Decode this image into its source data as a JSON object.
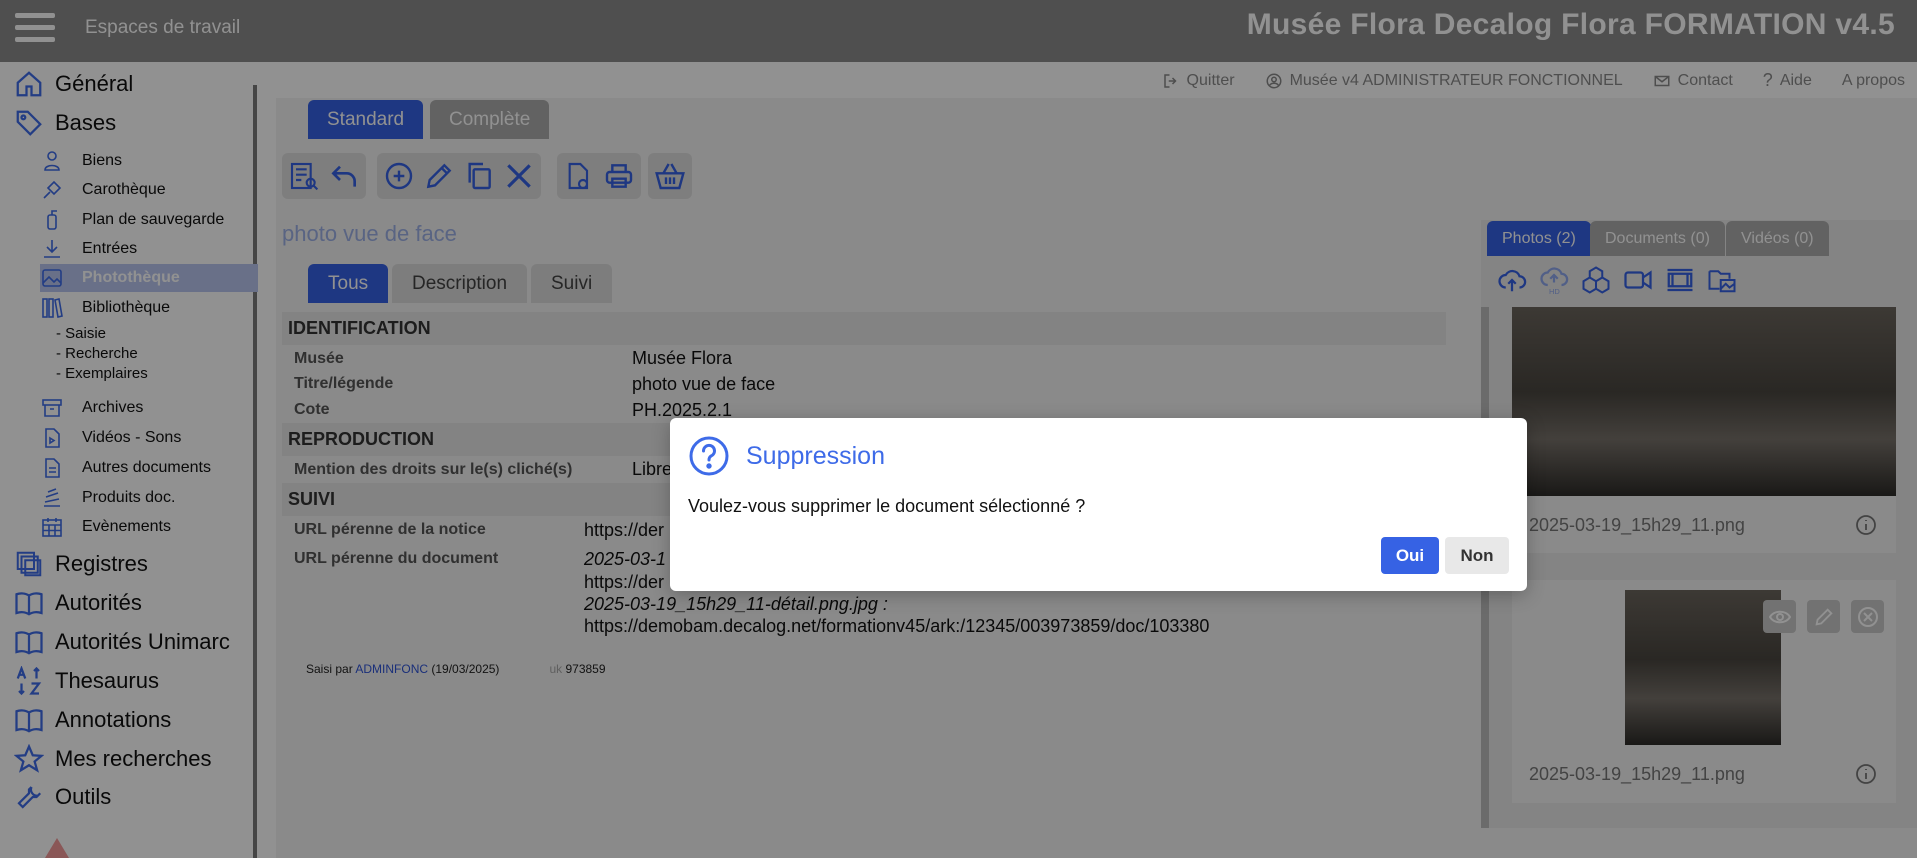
{
  "header": {
    "workspaces_label": "Espaces de travail",
    "app_title": "Musée Flora Decalog Flora FORMATION v4.5"
  },
  "top_links": {
    "quit": "Quitter",
    "user": "Musée v4 ADMINISTRATEUR FONCTIONNEL",
    "contact": "Contact",
    "help": "Aide",
    "about": "A propos"
  },
  "sidebar": {
    "general": "Général",
    "bases": "Bases",
    "sub": {
      "biens": "Biens",
      "carotheque": "Carothèque",
      "plan": "Plan de sauvegarde",
      "entrees": "Entrées",
      "phototheque": "Photothèque",
      "bibliotheque": "Bibliothèque",
      "saisie": "- Saisie",
      "recherche": "- Recherche",
      "exemplaires": "- Exemplaires",
      "archives": "Archives",
      "videos": "Vidéos - Sons",
      "autres": "Autres documents",
      "produits": "Produits doc.",
      "evenements": "Evènements"
    },
    "registres": "Registres",
    "autorites": "Autorités",
    "autorites_unimarc": "Autorités Unimarc",
    "thesaurus": "Thesaurus",
    "annotations": "Annotations",
    "mes_recherches": "Mes recherches",
    "outils": "Outils"
  },
  "mode_tabs": {
    "standard": "Standard",
    "complete": "Complète"
  },
  "record_title": "photo vue de face",
  "section_tabs": {
    "tous": "Tous",
    "description": "Description",
    "suivi": "Suivi"
  },
  "sections": {
    "identification": "IDENTIFICATION",
    "reproduction": "REPRODUCTION",
    "suivi": "SUIVI"
  },
  "fields": {
    "musee": {
      "label": "Musée",
      "value": "Musée Flora"
    },
    "titre": {
      "label": "Titre/légende",
      "value": "photo vue de face"
    },
    "cote": {
      "label": "Cote",
      "value": "PH.2025.2.1"
    },
    "droits": {
      "label": "Mention des droits sur le(s) cliché(s)",
      "value": "Libre"
    },
    "url_notice": {
      "label": "URL pérenne de la notice",
      "value": "https://der"
    },
    "url_doc": {
      "label": "URL pérenne du document",
      "line1": "2025-03-1",
      "line2": "https://der",
      "line3": "2025-03-19_15h29_11-détail.png.jpg :",
      "line4": "https://demobam.decalog.net/formationv45/ark:/12345/003973859/doc/103380"
    }
  },
  "footer": {
    "saisi_par": "Saisi par",
    "user": "ADMINFONC",
    "date": "(19/03/2025)",
    "uk_label": "uk",
    "uk_value": "973859"
  },
  "media_tabs": {
    "photos": "Photos (2)",
    "documents": "Documents (0)",
    "videos": "Vidéos (0)"
  },
  "media": [
    {
      "name": "2025-03-19_15h29_11.png"
    },
    {
      "name": "2025-03-19_15h29_11.png"
    }
  ],
  "dialog": {
    "title": "Suppression",
    "message": "Voulez-vous supprimer le document sélectionné ?",
    "yes": "Oui",
    "no": "Non"
  },
  "colors": {
    "accent": "#3662e4",
    "header_bg": "#8c8c8c",
    "active_nav": "#b9c6ef",
    "icon_blue": "#3e6be8"
  }
}
